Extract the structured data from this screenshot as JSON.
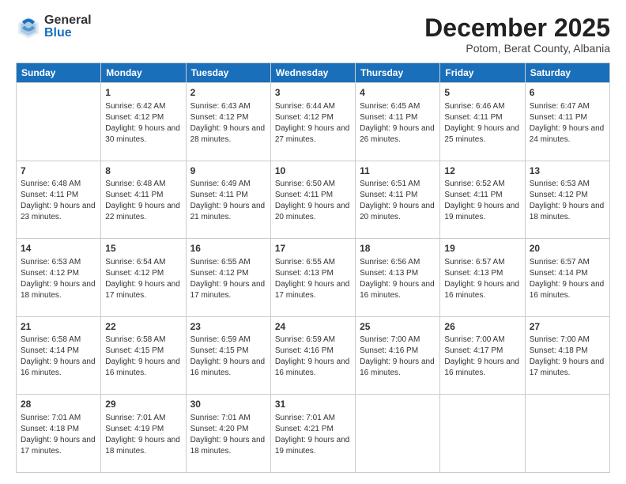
{
  "header": {
    "logo": {
      "general": "General",
      "blue": "Blue"
    },
    "title": "December 2025",
    "location": "Potom, Berat County, Albania"
  },
  "days_of_week": [
    "Sunday",
    "Monday",
    "Tuesday",
    "Wednesday",
    "Thursday",
    "Friday",
    "Saturday"
  ],
  "weeks": [
    [
      {
        "day": "",
        "sunrise": "",
        "sunset": "",
        "daylight": ""
      },
      {
        "day": "1",
        "sunrise": "Sunrise: 6:42 AM",
        "sunset": "Sunset: 4:12 PM",
        "daylight": "Daylight: 9 hours and 30 minutes."
      },
      {
        "day": "2",
        "sunrise": "Sunrise: 6:43 AM",
        "sunset": "Sunset: 4:12 PM",
        "daylight": "Daylight: 9 hours and 28 minutes."
      },
      {
        "day": "3",
        "sunrise": "Sunrise: 6:44 AM",
        "sunset": "Sunset: 4:12 PM",
        "daylight": "Daylight: 9 hours and 27 minutes."
      },
      {
        "day": "4",
        "sunrise": "Sunrise: 6:45 AM",
        "sunset": "Sunset: 4:11 PM",
        "daylight": "Daylight: 9 hours and 26 minutes."
      },
      {
        "day": "5",
        "sunrise": "Sunrise: 6:46 AM",
        "sunset": "Sunset: 4:11 PM",
        "daylight": "Daylight: 9 hours and 25 minutes."
      },
      {
        "day": "6",
        "sunrise": "Sunrise: 6:47 AM",
        "sunset": "Sunset: 4:11 PM",
        "daylight": "Daylight: 9 hours and 24 minutes."
      }
    ],
    [
      {
        "day": "7",
        "sunrise": "Sunrise: 6:48 AM",
        "sunset": "Sunset: 4:11 PM",
        "daylight": "Daylight: 9 hours and 23 minutes."
      },
      {
        "day": "8",
        "sunrise": "Sunrise: 6:48 AM",
        "sunset": "Sunset: 4:11 PM",
        "daylight": "Daylight: 9 hours and 22 minutes."
      },
      {
        "day": "9",
        "sunrise": "Sunrise: 6:49 AM",
        "sunset": "Sunset: 4:11 PM",
        "daylight": "Daylight: 9 hours and 21 minutes."
      },
      {
        "day": "10",
        "sunrise": "Sunrise: 6:50 AM",
        "sunset": "Sunset: 4:11 PM",
        "daylight": "Daylight: 9 hours and 20 minutes."
      },
      {
        "day": "11",
        "sunrise": "Sunrise: 6:51 AM",
        "sunset": "Sunset: 4:11 PM",
        "daylight": "Daylight: 9 hours and 20 minutes."
      },
      {
        "day": "12",
        "sunrise": "Sunrise: 6:52 AM",
        "sunset": "Sunset: 4:11 PM",
        "daylight": "Daylight: 9 hours and 19 minutes."
      },
      {
        "day": "13",
        "sunrise": "Sunrise: 6:53 AM",
        "sunset": "Sunset: 4:12 PM",
        "daylight": "Daylight: 9 hours and 18 minutes."
      }
    ],
    [
      {
        "day": "14",
        "sunrise": "Sunrise: 6:53 AM",
        "sunset": "Sunset: 4:12 PM",
        "daylight": "Daylight: 9 hours and 18 minutes."
      },
      {
        "day": "15",
        "sunrise": "Sunrise: 6:54 AM",
        "sunset": "Sunset: 4:12 PM",
        "daylight": "Daylight: 9 hours and 17 minutes."
      },
      {
        "day": "16",
        "sunrise": "Sunrise: 6:55 AM",
        "sunset": "Sunset: 4:12 PM",
        "daylight": "Daylight: 9 hours and 17 minutes."
      },
      {
        "day": "17",
        "sunrise": "Sunrise: 6:55 AM",
        "sunset": "Sunset: 4:13 PM",
        "daylight": "Daylight: 9 hours and 17 minutes."
      },
      {
        "day": "18",
        "sunrise": "Sunrise: 6:56 AM",
        "sunset": "Sunset: 4:13 PM",
        "daylight": "Daylight: 9 hours and 16 minutes."
      },
      {
        "day": "19",
        "sunrise": "Sunrise: 6:57 AM",
        "sunset": "Sunset: 4:13 PM",
        "daylight": "Daylight: 9 hours and 16 minutes."
      },
      {
        "day": "20",
        "sunrise": "Sunrise: 6:57 AM",
        "sunset": "Sunset: 4:14 PM",
        "daylight": "Daylight: 9 hours and 16 minutes."
      }
    ],
    [
      {
        "day": "21",
        "sunrise": "Sunrise: 6:58 AM",
        "sunset": "Sunset: 4:14 PM",
        "daylight": "Daylight: 9 hours and 16 minutes."
      },
      {
        "day": "22",
        "sunrise": "Sunrise: 6:58 AM",
        "sunset": "Sunset: 4:15 PM",
        "daylight": "Daylight: 9 hours and 16 minutes."
      },
      {
        "day": "23",
        "sunrise": "Sunrise: 6:59 AM",
        "sunset": "Sunset: 4:15 PM",
        "daylight": "Daylight: 9 hours and 16 minutes."
      },
      {
        "day": "24",
        "sunrise": "Sunrise: 6:59 AM",
        "sunset": "Sunset: 4:16 PM",
        "daylight": "Daylight: 9 hours and 16 minutes."
      },
      {
        "day": "25",
        "sunrise": "Sunrise: 7:00 AM",
        "sunset": "Sunset: 4:16 PM",
        "daylight": "Daylight: 9 hours and 16 minutes."
      },
      {
        "day": "26",
        "sunrise": "Sunrise: 7:00 AM",
        "sunset": "Sunset: 4:17 PM",
        "daylight": "Daylight: 9 hours and 16 minutes."
      },
      {
        "day": "27",
        "sunrise": "Sunrise: 7:00 AM",
        "sunset": "Sunset: 4:18 PM",
        "daylight": "Daylight: 9 hours and 17 minutes."
      }
    ],
    [
      {
        "day": "28",
        "sunrise": "Sunrise: 7:01 AM",
        "sunset": "Sunset: 4:18 PM",
        "daylight": "Daylight: 9 hours and 17 minutes."
      },
      {
        "day": "29",
        "sunrise": "Sunrise: 7:01 AM",
        "sunset": "Sunset: 4:19 PM",
        "daylight": "Daylight: 9 hours and 18 minutes."
      },
      {
        "day": "30",
        "sunrise": "Sunrise: 7:01 AM",
        "sunset": "Sunset: 4:20 PM",
        "daylight": "Daylight: 9 hours and 18 minutes."
      },
      {
        "day": "31",
        "sunrise": "Sunrise: 7:01 AM",
        "sunset": "Sunset: 4:21 PM",
        "daylight": "Daylight: 9 hours and 19 minutes."
      },
      {
        "day": "",
        "sunrise": "",
        "sunset": "",
        "daylight": ""
      },
      {
        "day": "",
        "sunrise": "",
        "sunset": "",
        "daylight": ""
      },
      {
        "day": "",
        "sunrise": "",
        "sunset": "",
        "daylight": ""
      }
    ]
  ]
}
